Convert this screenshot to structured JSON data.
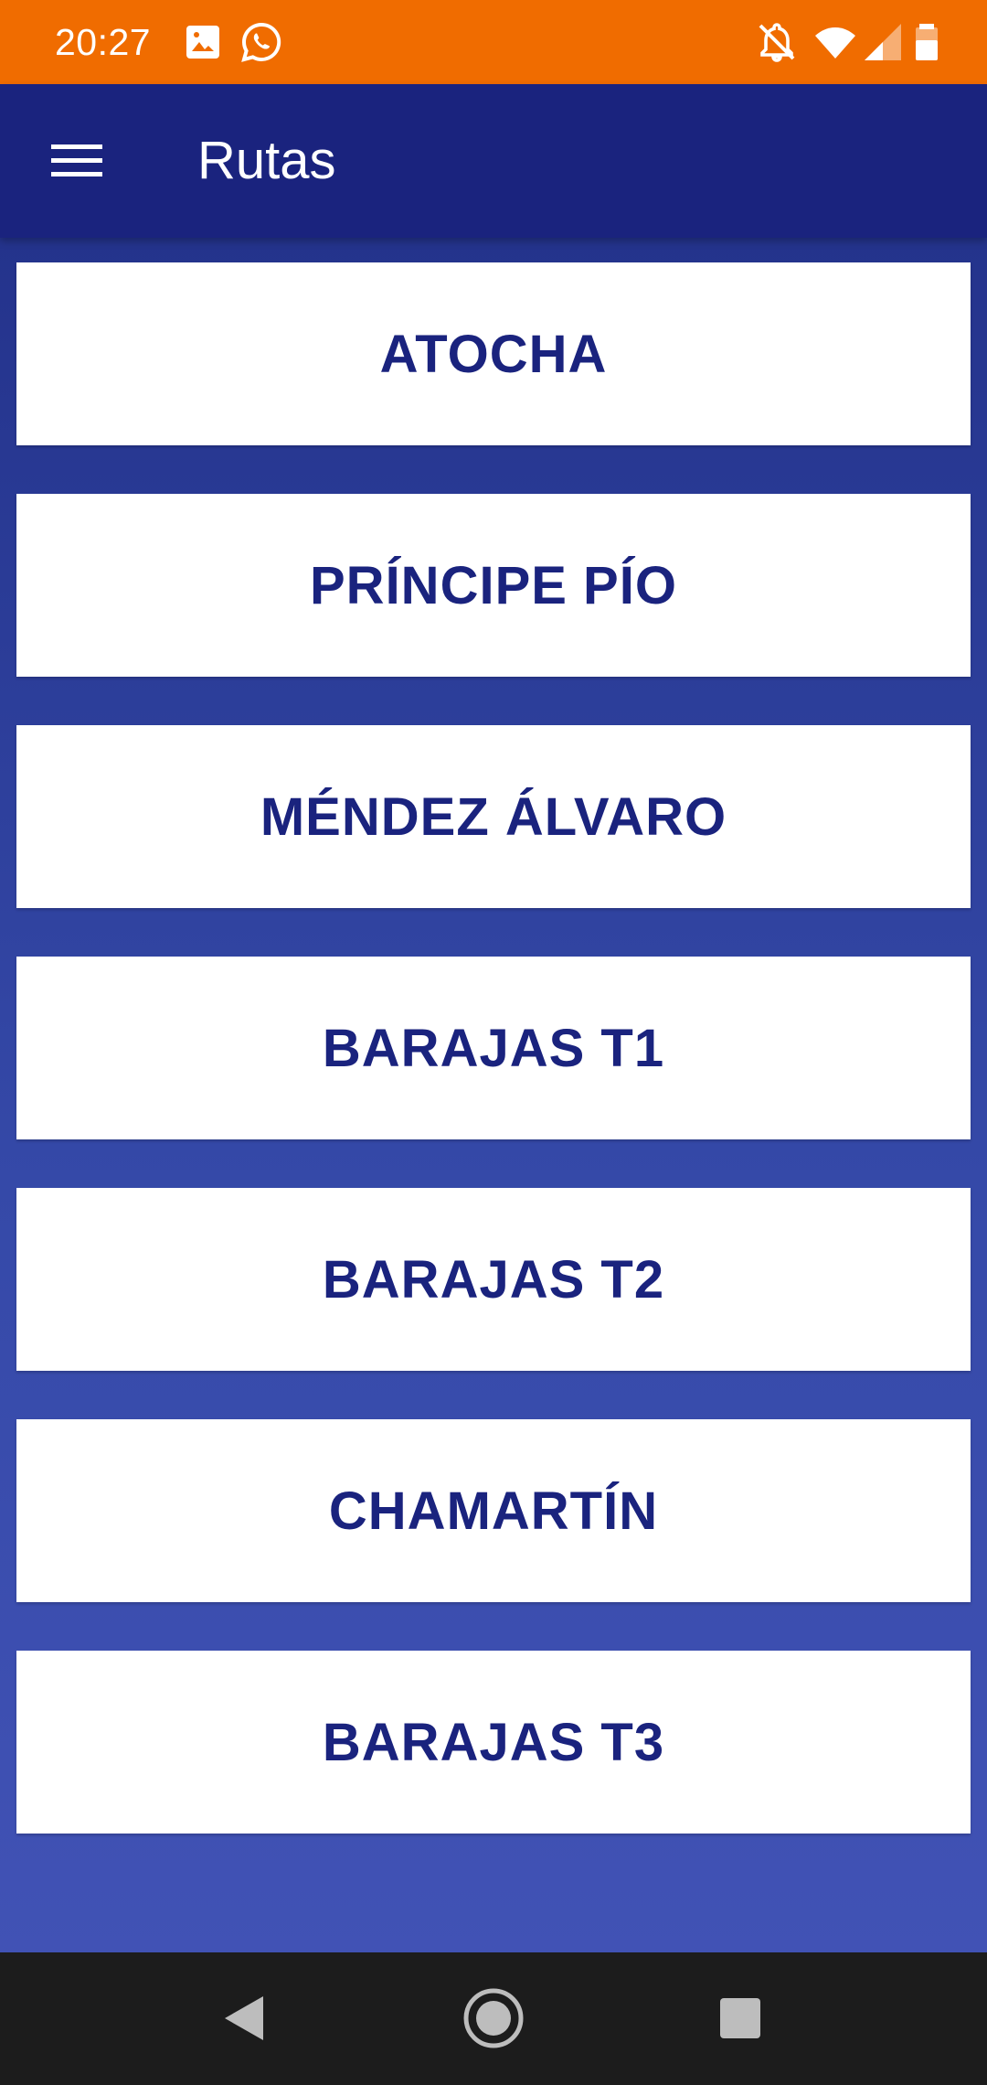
{
  "status_bar": {
    "time": "20:27",
    "left_icons": [
      "image-icon",
      "whatsapp-icon"
    ],
    "right_icons": [
      "notifications-off-icon",
      "wifi-icon",
      "cell-signal-icon",
      "battery-icon"
    ],
    "background_color": "#f06c00"
  },
  "app_bar": {
    "title": "Rutas",
    "menu_icon": "hamburger-menu-icon",
    "background_color": "#1a237e"
  },
  "routes": [
    {
      "label": "ATOCHA"
    },
    {
      "label": "PRÍNCIPE PÍO"
    },
    {
      "label": "MÉNDEZ ÁLVARO"
    },
    {
      "label": "BARAJAS T1"
    },
    {
      "label": "BARAJAS T2"
    },
    {
      "label": "CHAMARTÍN"
    },
    {
      "label": "BARAJAS T3"
    }
  ],
  "nav_bar": {
    "buttons": [
      "back-icon",
      "home-icon",
      "recents-icon"
    ]
  },
  "colors": {
    "accent": "#1a237e",
    "content_top": "#24338c",
    "content_bottom": "#4152b5",
    "button_text": "#1a237e"
  }
}
